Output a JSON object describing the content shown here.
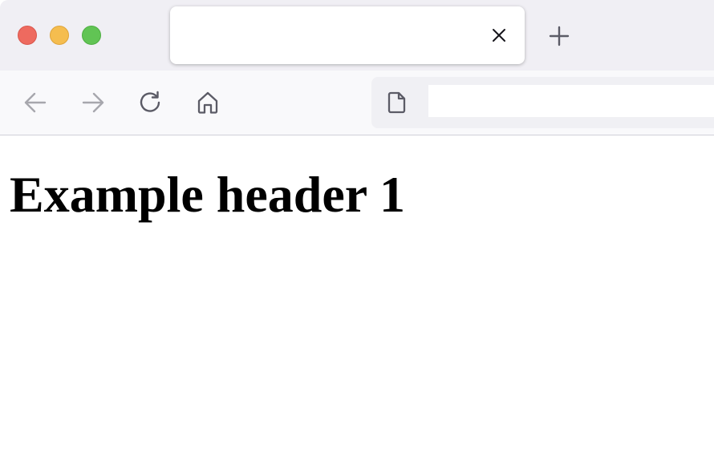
{
  "browser": {
    "tab": {
      "title": "",
      "close_icon": "close-icon"
    },
    "new_tab_icon": "plus-icon",
    "toolbar": {
      "back_icon": "arrow-left-icon",
      "forward_icon": "arrow-right-icon",
      "reload_icon": "reload-icon",
      "home_icon": "home-icon",
      "address": {
        "site_icon": "page-icon",
        "value": "",
        "placeholder": ""
      }
    }
  },
  "page": {
    "heading": "Example header 1"
  },
  "colors": {
    "traffic_close": "#ee6a5f",
    "traffic_minimize": "#f5bd4f",
    "traffic_maximize": "#61c454",
    "tabstrip_bg": "#f0eff4",
    "toolbar_bg": "#f9f9fb"
  }
}
